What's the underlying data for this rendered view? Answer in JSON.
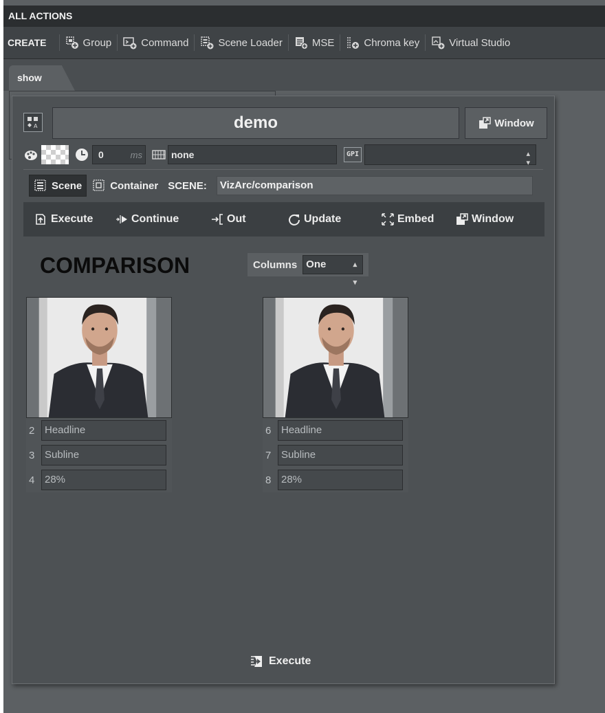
{
  "header": {
    "title": "ALL ACTIONS"
  },
  "create_bar": {
    "label": "CREATE",
    "items": [
      {
        "label": "Group",
        "icon": "group-add-icon"
      },
      {
        "label": "Command",
        "icon": "command-add-icon"
      },
      {
        "label": "Scene Loader",
        "icon": "scene-loader-add-icon"
      },
      {
        "label": "MSE",
        "icon": "mse-add-icon"
      },
      {
        "label": "Chroma key",
        "icon": "chroma-key-add-icon"
      },
      {
        "label": "Virtual Studio",
        "icon": "virtual-studio-add-icon"
      }
    ]
  },
  "tabs": [
    {
      "label": "show"
    }
  ],
  "panel": {
    "name": "demo",
    "window_button": "Window",
    "delay_value": "0",
    "delay_unit": "ms",
    "template_value": "none",
    "gpi_label": "GPI",
    "gpi_value": "",
    "scene_toggle": "Scene",
    "container_toggle": "Container",
    "scene_label": "SCENE:",
    "scene_path": "VizArc/comparison",
    "actions": {
      "execute": "Execute",
      "continue": "Continue",
      "out": "Out",
      "update": "Update",
      "embed": "Embed",
      "window": "Window"
    },
    "template_title": "COMPARISON",
    "columns_label": "Columns",
    "columns_value": "One",
    "cards": [
      {
        "fields": [
          {
            "num": "2",
            "value": "Headline"
          },
          {
            "num": "3",
            "value": "Subline"
          },
          {
            "num": "4",
            "value": "28%"
          }
        ]
      },
      {
        "fields": [
          {
            "num": "6",
            "value": "Headline"
          },
          {
            "num": "7",
            "value": "Subline"
          },
          {
            "num": "8",
            "value": "28%"
          }
        ]
      }
    ],
    "bottom_execute": "Execute"
  },
  "colors": {
    "app_bg": "#5c6063",
    "header_bg": "#2b2e30",
    "panel_bg": "#4d5154",
    "action_bar_bg": "#3b3f42",
    "title_text": "#0b0b0b"
  }
}
